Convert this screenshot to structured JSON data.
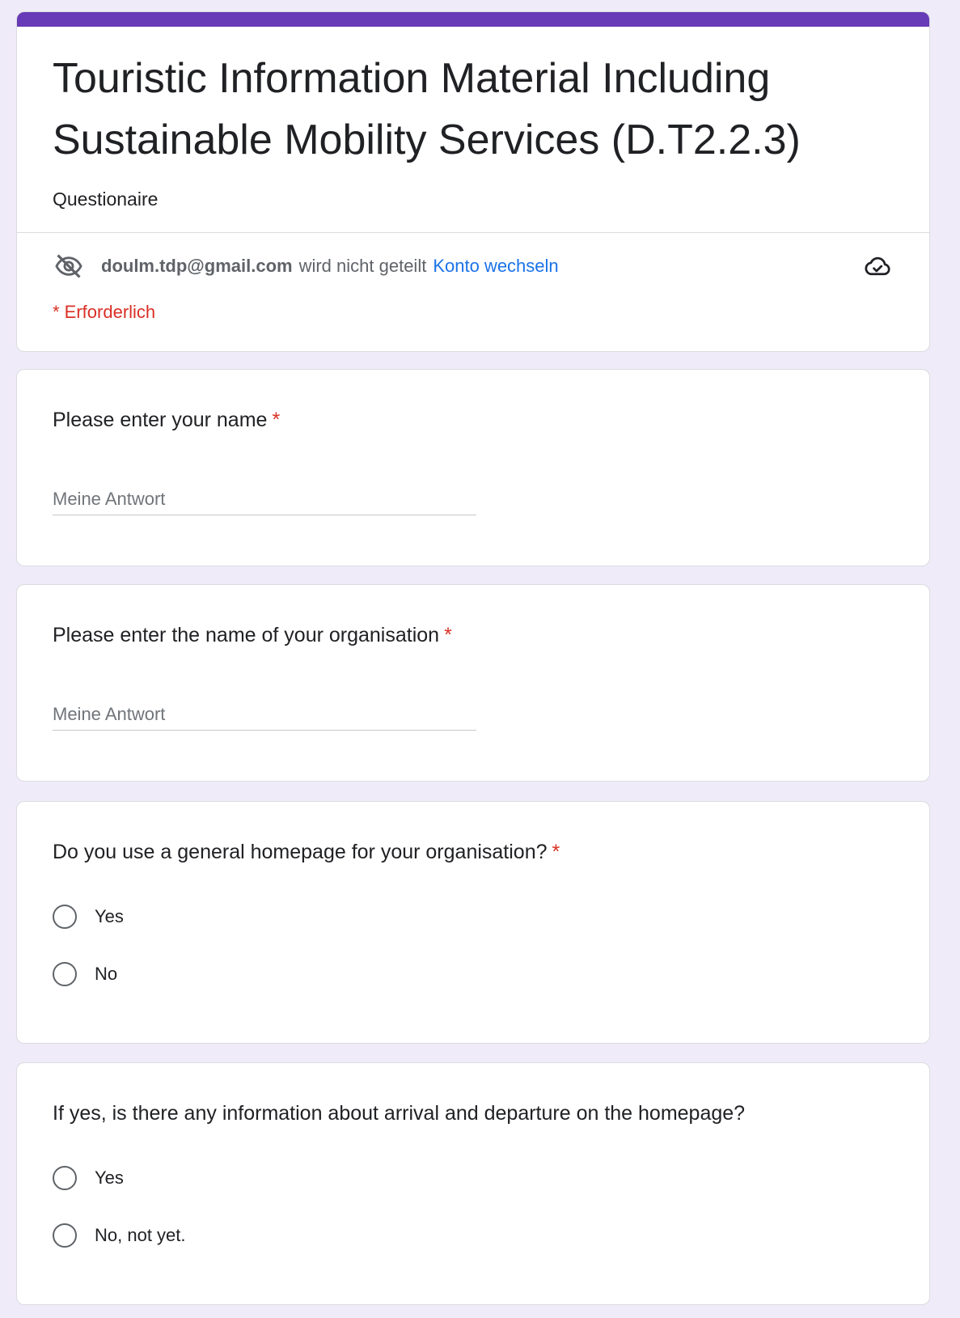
{
  "form": {
    "title": "Touristic Information Material Including Sustainable Mobility Services (D.T2.2.3)",
    "description": "Questionaire",
    "accent_color": "#673ab7",
    "account": {
      "email": "doulm.tdp@gmail.com",
      "status": "wird nicht geteilt",
      "switch_label": "Konto wechseln",
      "hidden_icon": "eye-off-icon",
      "save_icon": "cloud-check-icon"
    },
    "required_note": "* Erforderlich"
  },
  "questions": [
    {
      "title": "Please enter your name",
      "required_marker": "*",
      "placeholder": "Meine Antwort"
    },
    {
      "title": "Please enter the name of your organisation",
      "required_marker": "*",
      "placeholder": "Meine Antwort"
    },
    {
      "title": "Do you use a general homepage for your organisation?",
      "required_marker": "*",
      "options": [
        "Yes",
        "No"
      ]
    },
    {
      "title": "If yes, is there any information about arrival and departure on the homepage?",
      "options": [
        "Yes",
        "No, not yet."
      ]
    }
  ],
  "colors": {
    "background": "#f0ebf8",
    "required": "#d93025",
    "link": "#1a73e8"
  }
}
